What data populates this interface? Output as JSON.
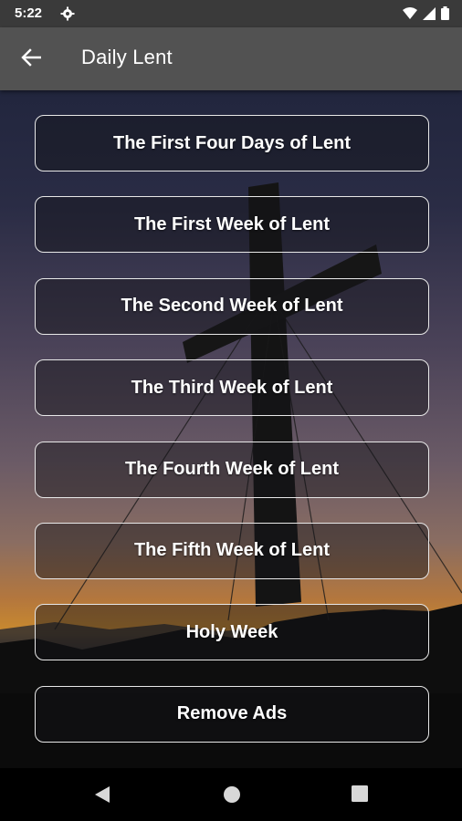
{
  "status_bar": {
    "time": "5:22",
    "icons": [
      "gear-icon",
      "wifi-icon",
      "signal-icon",
      "battery-icon"
    ]
  },
  "app_bar": {
    "back_icon": "arrow-left-icon",
    "title": "Daily Lent"
  },
  "menu": {
    "items": [
      {
        "label": "The First Four Days of Lent"
      },
      {
        "label": "The First Week of Lent"
      },
      {
        "label": "The Second Week of Lent"
      },
      {
        "label": "The Third Week of Lent"
      },
      {
        "label": "The Fourth Week of Lent"
      },
      {
        "label": "The Fifth Week of Lent"
      },
      {
        "label": "Holy Week"
      },
      {
        "label": "Remove Ads"
      }
    ]
  },
  "nav_bar": {
    "icons": [
      "back-triangle-icon",
      "home-circle-icon",
      "recents-square-icon"
    ]
  },
  "colors": {
    "status_bar_bg": "#3a3a3a",
    "app_bar_bg": "#525252",
    "button_border": "#e8e8e8",
    "text": "#ffffff"
  }
}
